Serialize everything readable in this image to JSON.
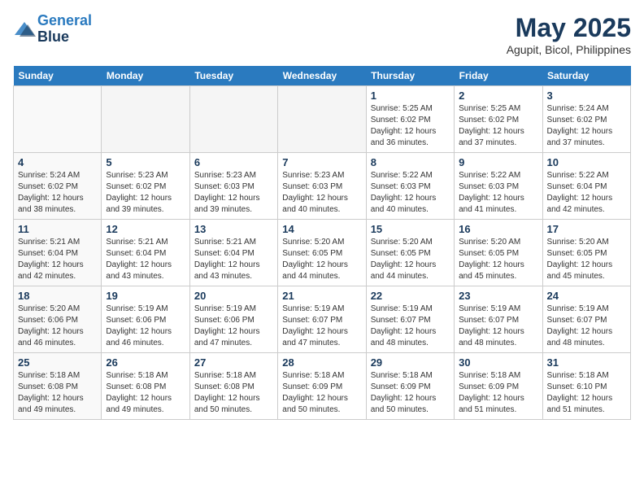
{
  "header": {
    "logo_line1": "General",
    "logo_line2": "Blue",
    "month": "May 2025",
    "location": "Agupit, Bicol, Philippines"
  },
  "weekdays": [
    "Sunday",
    "Monday",
    "Tuesday",
    "Wednesday",
    "Thursday",
    "Friday",
    "Saturday"
  ],
  "weeks": [
    [
      {
        "day": "",
        "info": ""
      },
      {
        "day": "",
        "info": ""
      },
      {
        "day": "",
        "info": ""
      },
      {
        "day": "",
        "info": ""
      },
      {
        "day": "1",
        "info": "Sunrise: 5:25 AM\nSunset: 6:02 PM\nDaylight: 12 hours\nand 36 minutes."
      },
      {
        "day": "2",
        "info": "Sunrise: 5:25 AM\nSunset: 6:02 PM\nDaylight: 12 hours\nand 37 minutes."
      },
      {
        "day": "3",
        "info": "Sunrise: 5:24 AM\nSunset: 6:02 PM\nDaylight: 12 hours\nand 37 minutes."
      }
    ],
    [
      {
        "day": "4",
        "info": "Sunrise: 5:24 AM\nSunset: 6:02 PM\nDaylight: 12 hours\nand 38 minutes."
      },
      {
        "day": "5",
        "info": "Sunrise: 5:23 AM\nSunset: 6:02 PM\nDaylight: 12 hours\nand 39 minutes."
      },
      {
        "day": "6",
        "info": "Sunrise: 5:23 AM\nSunset: 6:03 PM\nDaylight: 12 hours\nand 39 minutes."
      },
      {
        "day": "7",
        "info": "Sunrise: 5:23 AM\nSunset: 6:03 PM\nDaylight: 12 hours\nand 40 minutes."
      },
      {
        "day": "8",
        "info": "Sunrise: 5:22 AM\nSunset: 6:03 PM\nDaylight: 12 hours\nand 40 minutes."
      },
      {
        "day": "9",
        "info": "Sunrise: 5:22 AM\nSunset: 6:03 PM\nDaylight: 12 hours\nand 41 minutes."
      },
      {
        "day": "10",
        "info": "Sunrise: 5:22 AM\nSunset: 6:04 PM\nDaylight: 12 hours\nand 42 minutes."
      }
    ],
    [
      {
        "day": "11",
        "info": "Sunrise: 5:21 AM\nSunset: 6:04 PM\nDaylight: 12 hours\nand 42 minutes."
      },
      {
        "day": "12",
        "info": "Sunrise: 5:21 AM\nSunset: 6:04 PM\nDaylight: 12 hours\nand 43 minutes."
      },
      {
        "day": "13",
        "info": "Sunrise: 5:21 AM\nSunset: 6:04 PM\nDaylight: 12 hours\nand 43 minutes."
      },
      {
        "day": "14",
        "info": "Sunrise: 5:20 AM\nSunset: 6:05 PM\nDaylight: 12 hours\nand 44 minutes."
      },
      {
        "day": "15",
        "info": "Sunrise: 5:20 AM\nSunset: 6:05 PM\nDaylight: 12 hours\nand 44 minutes."
      },
      {
        "day": "16",
        "info": "Sunrise: 5:20 AM\nSunset: 6:05 PM\nDaylight: 12 hours\nand 45 minutes."
      },
      {
        "day": "17",
        "info": "Sunrise: 5:20 AM\nSunset: 6:05 PM\nDaylight: 12 hours\nand 45 minutes."
      }
    ],
    [
      {
        "day": "18",
        "info": "Sunrise: 5:20 AM\nSunset: 6:06 PM\nDaylight: 12 hours\nand 46 minutes."
      },
      {
        "day": "19",
        "info": "Sunrise: 5:19 AM\nSunset: 6:06 PM\nDaylight: 12 hours\nand 46 minutes."
      },
      {
        "day": "20",
        "info": "Sunrise: 5:19 AM\nSunset: 6:06 PM\nDaylight: 12 hours\nand 47 minutes."
      },
      {
        "day": "21",
        "info": "Sunrise: 5:19 AM\nSunset: 6:07 PM\nDaylight: 12 hours\nand 47 minutes."
      },
      {
        "day": "22",
        "info": "Sunrise: 5:19 AM\nSunset: 6:07 PM\nDaylight: 12 hours\nand 48 minutes."
      },
      {
        "day": "23",
        "info": "Sunrise: 5:19 AM\nSunset: 6:07 PM\nDaylight: 12 hours\nand 48 minutes."
      },
      {
        "day": "24",
        "info": "Sunrise: 5:19 AM\nSunset: 6:07 PM\nDaylight: 12 hours\nand 48 minutes."
      }
    ],
    [
      {
        "day": "25",
        "info": "Sunrise: 5:18 AM\nSunset: 6:08 PM\nDaylight: 12 hours\nand 49 minutes."
      },
      {
        "day": "26",
        "info": "Sunrise: 5:18 AM\nSunset: 6:08 PM\nDaylight: 12 hours\nand 49 minutes."
      },
      {
        "day": "27",
        "info": "Sunrise: 5:18 AM\nSunset: 6:08 PM\nDaylight: 12 hours\nand 50 minutes."
      },
      {
        "day": "28",
        "info": "Sunrise: 5:18 AM\nSunset: 6:09 PM\nDaylight: 12 hours\nand 50 minutes."
      },
      {
        "day": "29",
        "info": "Sunrise: 5:18 AM\nSunset: 6:09 PM\nDaylight: 12 hours\nand 50 minutes."
      },
      {
        "day": "30",
        "info": "Sunrise: 5:18 AM\nSunset: 6:09 PM\nDaylight: 12 hours\nand 51 minutes."
      },
      {
        "day": "31",
        "info": "Sunrise: 5:18 AM\nSunset: 6:10 PM\nDaylight: 12 hours\nand 51 minutes."
      }
    ]
  ]
}
